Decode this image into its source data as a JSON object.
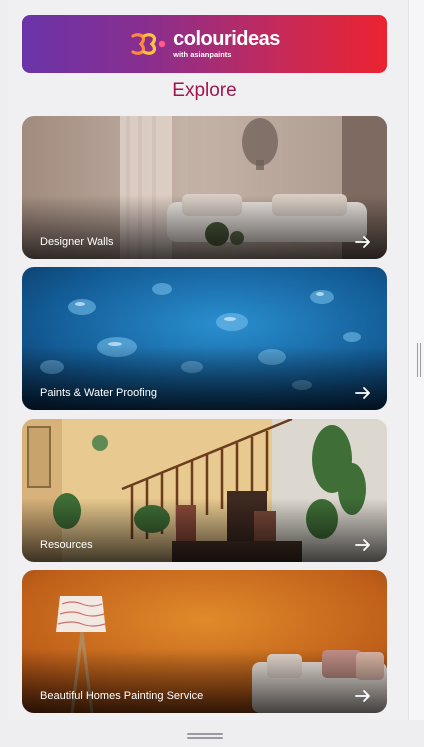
{
  "brand": {
    "name": "colourideas",
    "tagline": "with asianpaints",
    "gradient": [
      "#6a34a8",
      "#ec2330"
    ]
  },
  "section_title": "Explore",
  "title_color": "#a0154f",
  "cards": [
    {
      "label": "Designer Walls",
      "icon": "arrow-right-icon"
    },
    {
      "label": "Paints & Water Proofing",
      "icon": "arrow-right-icon"
    },
    {
      "label": "Resources",
      "icon": "arrow-right-icon"
    },
    {
      "label": "Beautiful Homes Painting Service",
      "icon": "arrow-right-icon"
    }
  ]
}
